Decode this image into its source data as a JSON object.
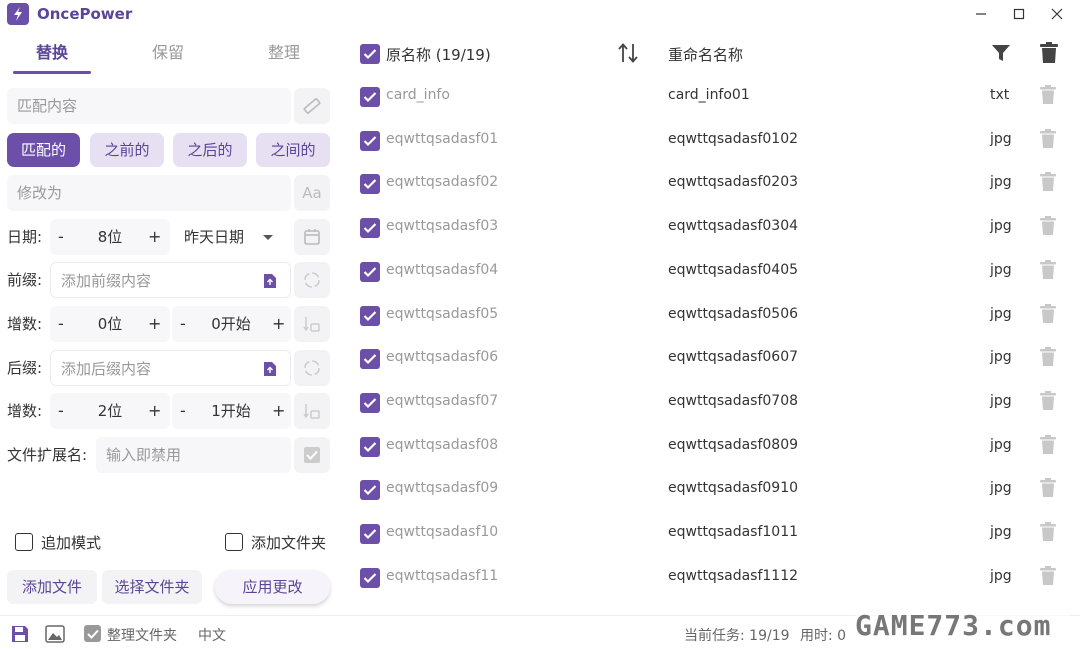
{
  "app": {
    "title": "OncePower"
  },
  "tabs": [
    {
      "label": "替换",
      "active": true
    },
    {
      "label": "保留",
      "active": false
    },
    {
      "label": "整理",
      "active": false
    }
  ],
  "replace": {
    "match_placeholder": "匹配内容",
    "modes": [
      "匹配的",
      "之前的",
      "之后的",
      "之间的"
    ],
    "active_mode": "匹配的",
    "change_to_placeholder": "修改为"
  },
  "date": {
    "label": "日期:",
    "minus": "-",
    "value": "8位",
    "plus": "+",
    "option": "昨天日期"
  },
  "prefix": {
    "label": "前缀:",
    "placeholder": "添加前缀内容"
  },
  "increment1": {
    "label": "增数:",
    "minus": "-",
    "digits": "0位",
    "plus": "+",
    "minus2": "-",
    "start": "0开始",
    "plus2": "+"
  },
  "suffix": {
    "label": "后缀:",
    "placeholder": "添加后缀内容"
  },
  "increment2": {
    "label": "增数:",
    "minus": "-",
    "digits": "2位",
    "plus": "+",
    "minus2": "-",
    "start": "1开始",
    "plus2": "+"
  },
  "extension": {
    "label": "文件扩展名:",
    "placeholder": "输入即禁用"
  },
  "options": {
    "append_mode": "追加模式",
    "add_folder": "添加文件夹"
  },
  "actions": {
    "add_files": "添加文件",
    "select_folder": "选择文件夹",
    "apply": "应用更改"
  },
  "table": {
    "header_original": "原名称 (19/19)",
    "header_renamed": "重命名名称",
    "rows": [
      {
        "original": "card_info",
        "renamed": "card_info01",
        "ext": "txt"
      },
      {
        "original": "eqwttqsadasf01",
        "renamed": "eqwttqsadasf0102",
        "ext": "jpg"
      },
      {
        "original": "eqwttqsadasf02",
        "renamed": "eqwttqsadasf0203",
        "ext": "jpg"
      },
      {
        "original": "eqwttqsadasf03",
        "renamed": "eqwttqsadasf0304",
        "ext": "jpg"
      },
      {
        "original": "eqwttqsadasf04",
        "renamed": "eqwttqsadasf0405",
        "ext": "jpg"
      },
      {
        "original": "eqwttqsadasf05",
        "renamed": "eqwttqsadasf0506",
        "ext": "jpg"
      },
      {
        "original": "eqwttqsadasf06",
        "renamed": "eqwttqsadasf0607",
        "ext": "jpg"
      },
      {
        "original": "eqwttqsadasf07",
        "renamed": "eqwttqsadasf0708",
        "ext": "jpg"
      },
      {
        "original": "eqwttqsadasf08",
        "renamed": "eqwttqsadasf0809",
        "ext": "jpg"
      },
      {
        "original": "eqwttqsadasf09",
        "renamed": "eqwttqsadasf0910",
        "ext": "jpg"
      },
      {
        "original": "eqwttqsadasf10",
        "renamed": "eqwttqsadasf1011",
        "ext": "jpg"
      },
      {
        "original": "eqwttqsadasf11",
        "renamed": "eqwttqsadasf1112",
        "ext": "jpg"
      }
    ]
  },
  "statusbar": {
    "organize_folder": "整理文件夹",
    "language": "中文",
    "task": "当前任务: 19/19",
    "time": "用时: 0"
  },
  "watermark": "GAME773.com",
  "colors": {
    "accent": "#6b4fa8",
    "accent_light": "#e6e0f2"
  }
}
